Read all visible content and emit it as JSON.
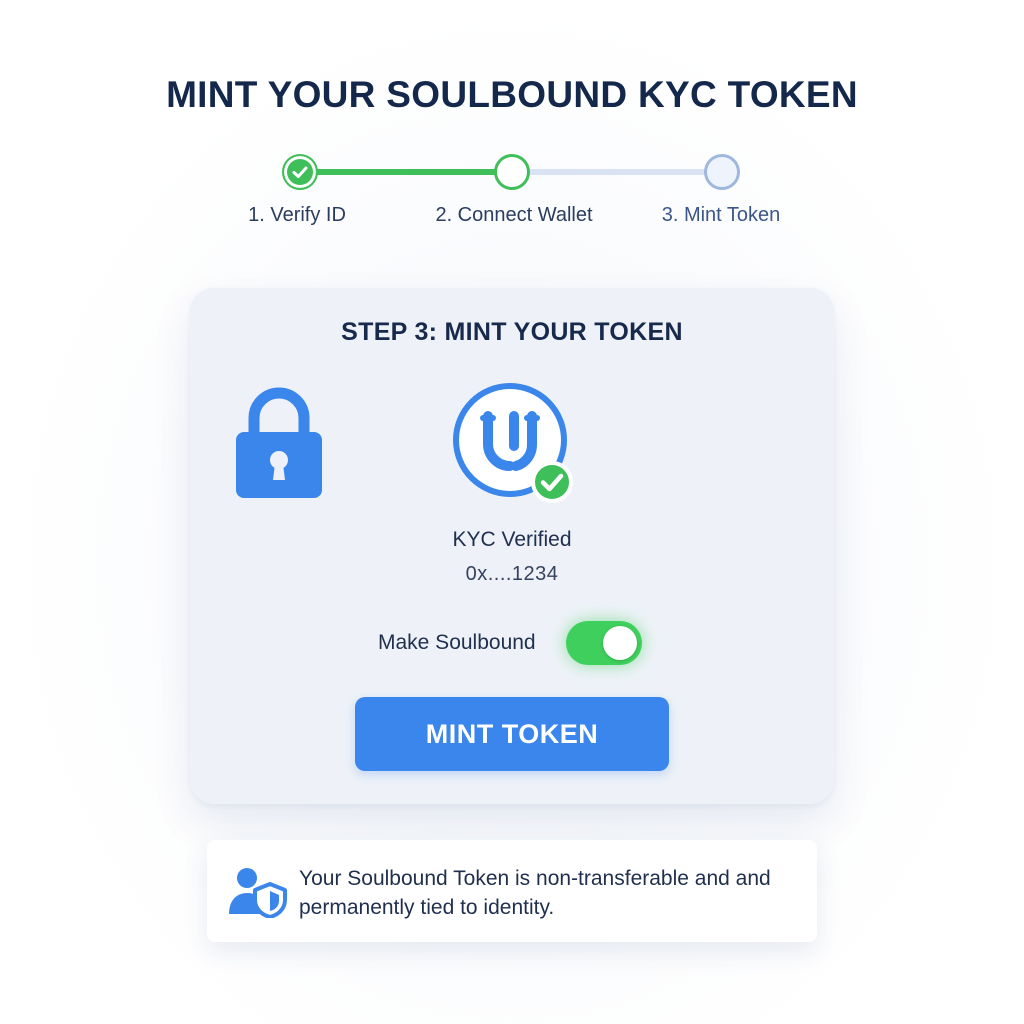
{
  "page": {
    "title": "MINT YOUR SOULBOUND KYC TOKEN"
  },
  "stepper": {
    "steps": [
      {
        "label": "1. Verify ID",
        "state": "completed"
      },
      {
        "label": "2. Connect Wallet",
        "state": "current"
      },
      {
        "label": "3. Mint Token",
        "state": "upcoming"
      }
    ]
  },
  "card": {
    "title": "STEP 3: MINT YOUR TOKEN",
    "status_label": "KYC Verified",
    "wallet_address": "0x....1234",
    "soulbound_toggle": {
      "label": "Make Soulbound",
      "checked": true
    },
    "mint_button_label": "MINT TOKEN"
  },
  "note": {
    "text": "Your Soulbound Token is non-transferable and and permanently tied to identity."
  },
  "colors": {
    "accent_blue": "#3b86ec",
    "success_green": "#3fbf5a",
    "title_navy": "#14284b",
    "card_background": "#eef2f8"
  },
  "icons": [
    "check-icon",
    "lock-icon",
    "kyc-token-badge-icon",
    "user-shield-icon"
  ]
}
